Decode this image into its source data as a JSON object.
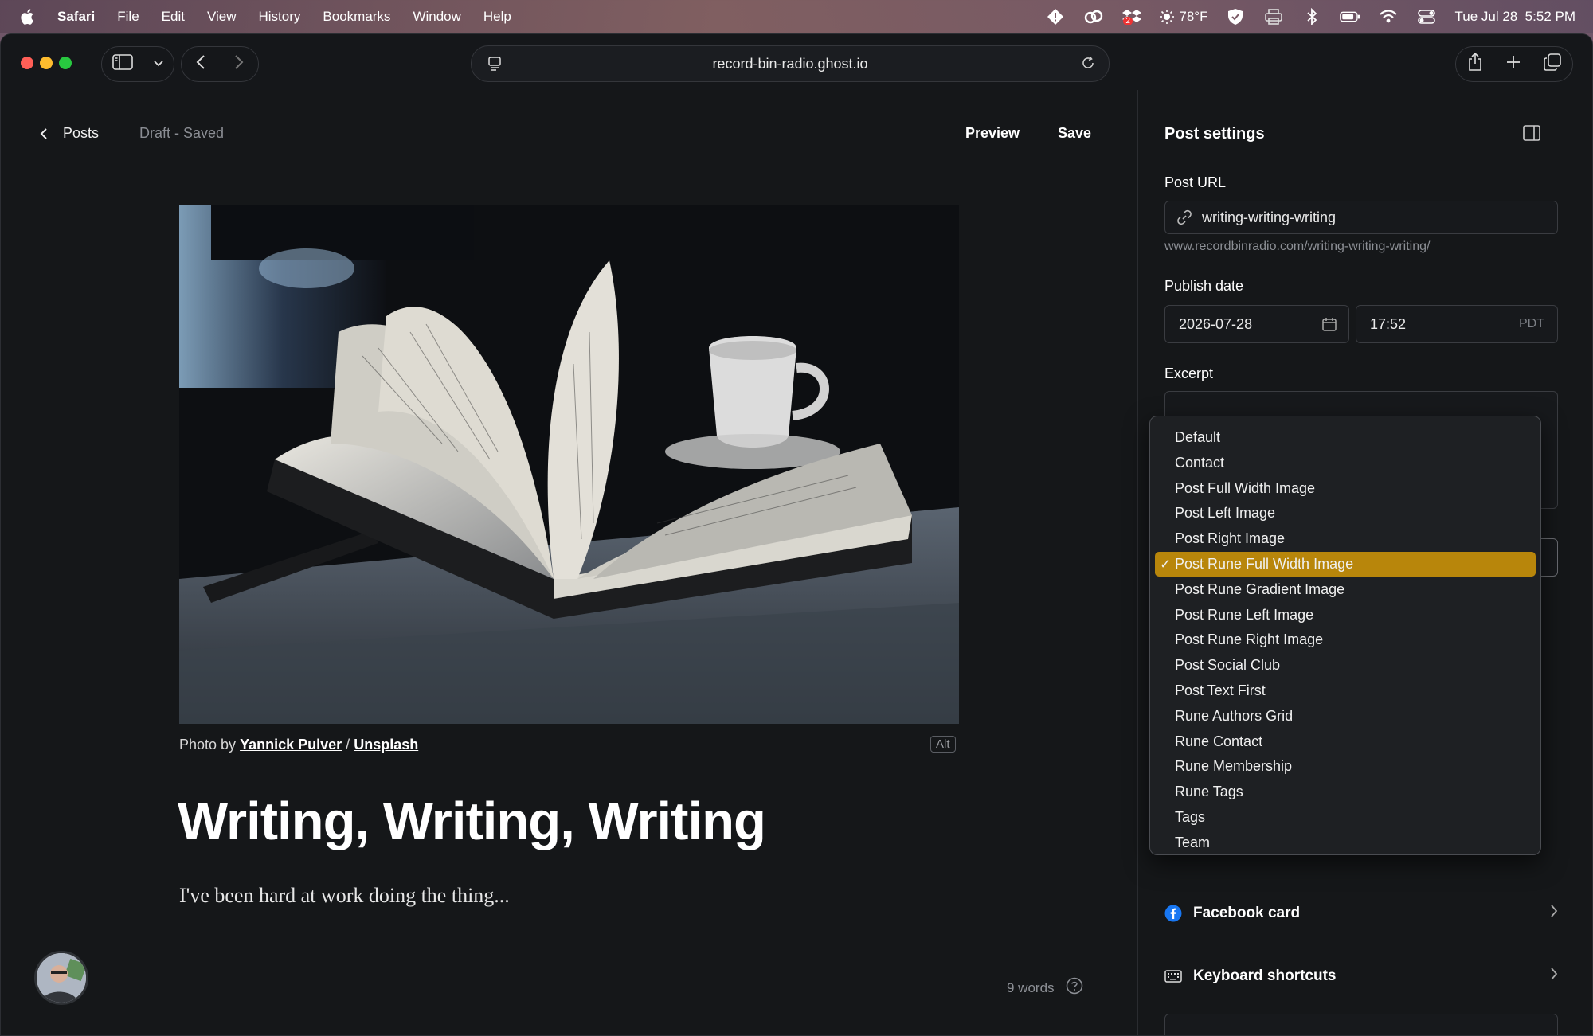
{
  "menubar": {
    "app": "Safari",
    "items": [
      "File",
      "Edit",
      "View",
      "History",
      "Bookmarks",
      "Window",
      "Help"
    ],
    "weather": "78°F",
    "datetime": "Tue Jul 28  5:52 PM",
    "dropbox_badge": "2"
  },
  "browser": {
    "url": "record-bin-radio.ghost.io"
  },
  "editor": {
    "back_label": "Posts",
    "status": "Draft - Saved",
    "preview_label": "Preview",
    "save_label": "Save",
    "caption_prefix": "Photo by",
    "caption_author": "Yannick Pulver",
    "caption_sep": "/",
    "caption_source": "Unsplash",
    "alt_label": "Alt",
    "title": "Writing, Writing, Writing",
    "excerpt": "I've been hard at work doing the thing...",
    "word_count": "9 words"
  },
  "settings": {
    "title": "Post settings",
    "post_url_label": "Post URL",
    "post_url_value": "writing-writing-writing",
    "post_url_hint": "www.recordbinradio.com/writing-writing-writing/",
    "publish_date_label": "Publish date",
    "date_value": "2026-07-28",
    "time_value": "17:52",
    "timezone": "PDT",
    "excerpt_label": "Excerpt",
    "facebook_card": "Facebook card",
    "keyboard_shortcuts": "Keyboard shortcuts"
  },
  "template_dropdown": {
    "selected_index": 5,
    "options": [
      "Default",
      "Contact",
      "Post Full Width Image",
      "Post Left Image",
      "Post Right Image",
      "Post Rune Full Width Image",
      "Post Rune Gradient Image",
      "Post Rune Left Image",
      "Post Rune Right Image",
      "Post Social Club",
      "Post Text First",
      "Rune Authors Grid",
      "Rune Contact",
      "Rune Membership",
      "Rune Tags",
      "Tags",
      "Team"
    ]
  },
  "colors": {
    "selection_highlight": "#b8860b",
    "background": "#15171a"
  }
}
